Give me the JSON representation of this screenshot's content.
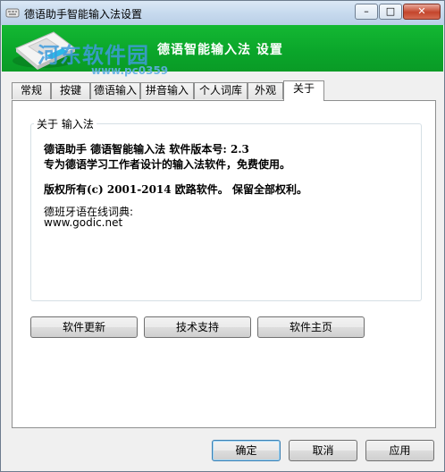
{
  "window": {
    "title": "德语助手智能输入法设置",
    "controls": {
      "minimize": "–",
      "maximize": "□",
      "close": "✕"
    }
  },
  "header": {
    "title": "德语智能输入法 设置",
    "watermark_main": "河东软件园",
    "watermark_url": "www.pc0359"
  },
  "tabs": [
    {
      "label": "常规"
    },
    {
      "label": "按键"
    },
    {
      "label": "德语输入"
    },
    {
      "label": "拼音输入"
    },
    {
      "label": "个人词库"
    },
    {
      "label": "外观"
    },
    {
      "label": "关于",
      "active": true
    }
  ],
  "about": {
    "group_label": "关于 输入法",
    "version_line": "德语助手 德语智能输入法 软件版本号: 2.3",
    "description_line": "专为德语学习工作者设计的输入法软件，免费使用。",
    "copyright_line": "版权所有(c) 2001-2014 欧路软件。 保留全部权利。",
    "dictionary_label": "德班牙语在线词典:",
    "dictionary_url": "www.godic.net"
  },
  "panel_buttons": {
    "update": "软件更新",
    "support": "技术支持",
    "homepage": "软件主页"
  },
  "dialog_buttons": {
    "ok": "确定",
    "cancel": "取消",
    "apply": "应用"
  },
  "colors": {
    "header_green": "#0aa52a",
    "header_text": "#ffffff",
    "watermark_blue": "#409bdc"
  }
}
